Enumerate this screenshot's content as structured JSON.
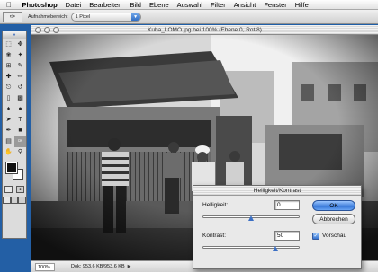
{
  "menubar": {
    "items": [
      "Photoshop",
      "Datei",
      "Bearbeiten",
      "Bild",
      "Ebene",
      "Auswahl",
      "Filter",
      "Ansicht",
      "Fenster",
      "Hilfe"
    ]
  },
  "options": {
    "label": "Aufnahmebereich:",
    "value": "1 Pixel"
  },
  "document": {
    "title": "Kuba_LOMO.jpg bei 100% (Ebene 0, Rot/8)",
    "zoom": "100%",
    "doc_info": "Dok: 953,6 KB/953,6 KB"
  },
  "dialog": {
    "title": "Helligkeit/Kontrast",
    "brightness_label": "Helligkeit:",
    "brightness_value": "0",
    "brightness_level": 0,
    "contrast_label": "Kontrast:",
    "contrast_value": "50",
    "contrast_level": 50,
    "ok": "OK",
    "cancel": "Abbrechen",
    "preview_label": "Vorschau",
    "preview_checked": true
  },
  "colors": {
    "desktop": "#1f5fa8",
    "accent": "#3a7ad9"
  }
}
